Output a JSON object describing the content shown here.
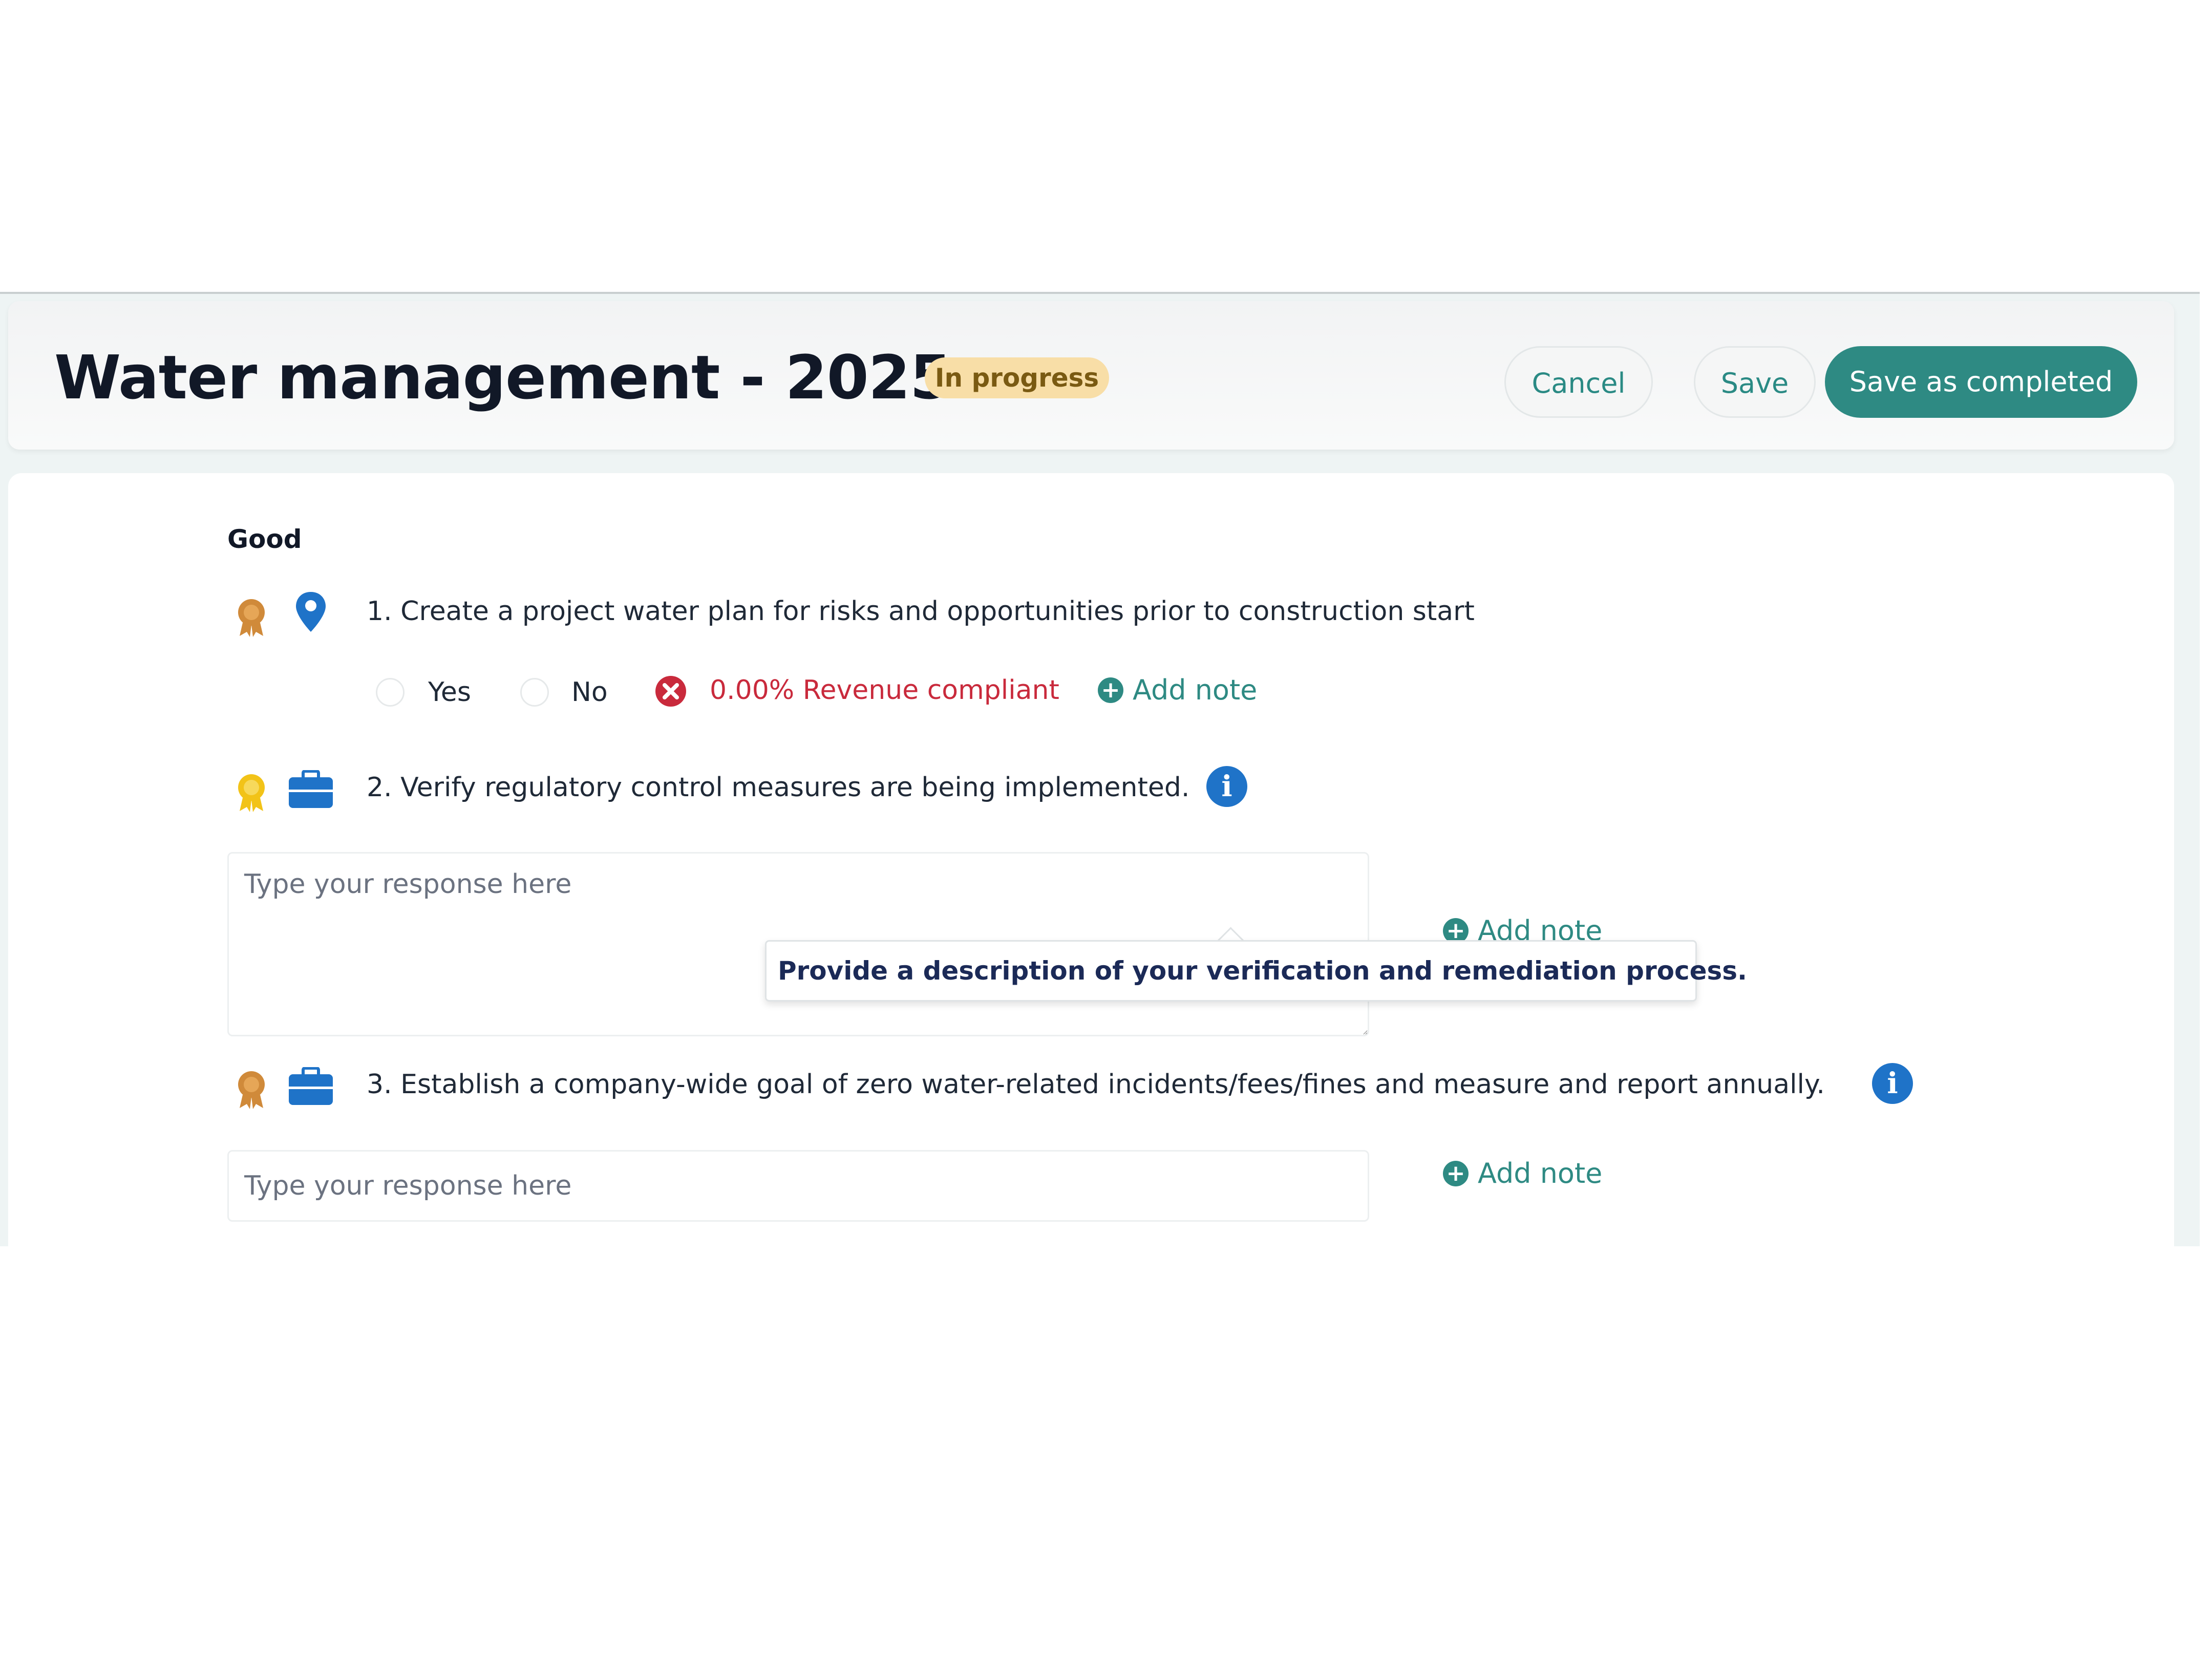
{
  "header": {
    "title": "Water management - 2025",
    "status_badge": "In progress",
    "cancel_label": "Cancel",
    "save_label": "Save",
    "save_completed_label": "Save as completed"
  },
  "section": {
    "label": "Good"
  },
  "questions": [
    {
      "text": "1. Create a project water plan for risks and opportunities prior to construction start",
      "options": [
        "Yes",
        "No"
      ],
      "compliance_text": "0.00% Revenue compliant",
      "add_note_label": "Add note",
      "icons": [
        "award-icon",
        "location-pin-icon"
      ]
    },
    {
      "text": "2. Verify regulatory control measures are being implemented.",
      "response_placeholder": "Type your response here",
      "add_note_label": "Add note",
      "tooltip": "Provide a description of your verification and remediation process.",
      "icons": [
        "award-icon",
        "briefcase-icon",
        "info-icon"
      ]
    },
    {
      "text": "3. Establish a company-wide goal of zero water-related incidents/fees/fines and measure and report annually.",
      "response_placeholder": "Type your response here",
      "add_note_label": "Add note",
      "icons": [
        "award-icon",
        "briefcase-icon",
        "info-icon"
      ]
    }
  ],
  "colors": {
    "accent": "#2e8a83",
    "badge_bg": "#f8dea7",
    "error": "#c92a3c",
    "info": "#1f73c8",
    "award_bronze": "#d08a3a",
    "award_gold": "#f2c318"
  }
}
